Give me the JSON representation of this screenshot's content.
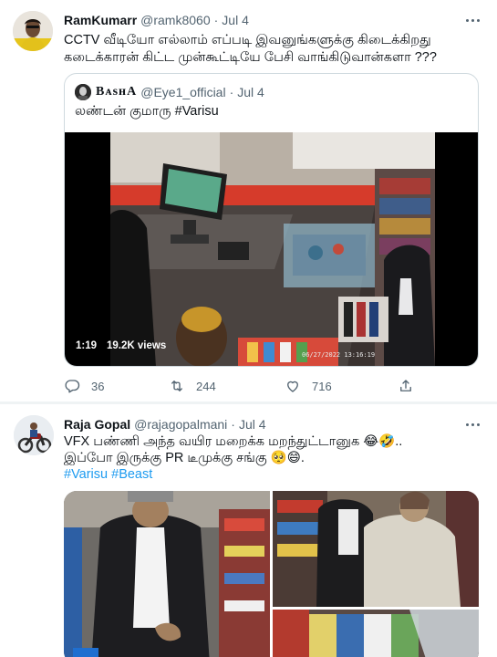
{
  "tweet1": {
    "author_name": "RamKumarr",
    "handle": "@ramk8060",
    "separator": "·",
    "date": "Jul 4",
    "text_line1": "CCTV வீடியோ எல்லாம் எப்படி இவனுங்களுக்கு கிடைக்கிறது",
    "text_line2": "கடைக்காரன் கிட்ட முன்கூட்டியே பேசி வாங்கிடுவான்களா ???",
    "quote": {
      "author_name": "BᴀsʜA",
      "handle": "@Eye1_official",
      "separator": "·",
      "date": "Jul 4",
      "text": "லண்டன் குமாரு #Varisu",
      "video": {
        "duration": "1:19",
        "views": "19.2K views",
        "timestamp": "06/27/2022 13:16:19"
      }
    },
    "actions": {
      "replies": "36",
      "retweets": "244",
      "likes": "716"
    }
  },
  "tweet2": {
    "author_name": "Raja Gopal",
    "handle": "@rajagopalmani",
    "separator": "·",
    "date": "Jul 4",
    "text_line1": "VFX பண்ணி அந்த வயிர மறைக்க மறந்துட்டானுக 😂🤣..",
    "text_line2": "இப்போ இருக்கு PR டீமுக்கு சங்கு 🥺😄.",
    "hashtag1": "#Varisu",
    "hashtag2": "#Beast"
  },
  "colors": {
    "link": "#1d9bf0",
    "secondary_text": "#536471",
    "border": "#cfd9de"
  },
  "icons": [
    "more-icon",
    "reply-icon",
    "retweet-icon",
    "like-icon",
    "share-icon"
  ]
}
